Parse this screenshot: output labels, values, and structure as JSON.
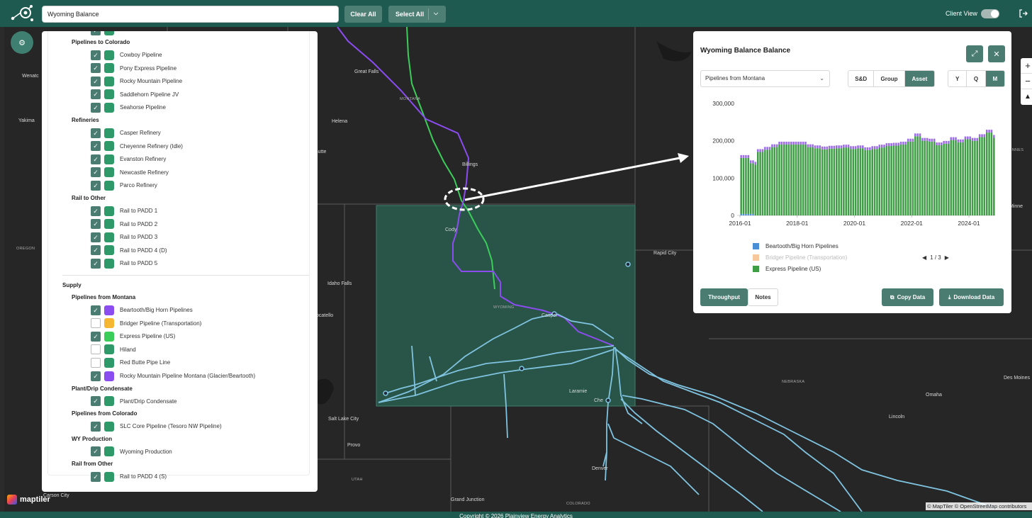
{
  "topbar": {
    "search_value": "Wyoming Balance",
    "clear_all": "Clear All",
    "select_all": "Select All",
    "client_view": "Client View"
  },
  "left_panel": {
    "groups": [
      {
        "title": "Pipelines to Colorado",
        "items": [
          {
            "label": "Cowboy Pipeline",
            "checked": true,
            "color": "#2e9a6a"
          },
          {
            "label": "Pony Express Pipeline",
            "checked": true,
            "color": "#2e9a6a"
          },
          {
            "label": "Rocky Mountain Pipeline",
            "checked": true,
            "color": "#2e9a6a"
          },
          {
            "label": "Saddlehorn Pipeline JV",
            "checked": true,
            "color": "#2e9a6a"
          },
          {
            "label": "Seahorse Pipeline",
            "checked": true,
            "color": "#2e9a6a"
          }
        ]
      },
      {
        "title": "Refineries",
        "items": [
          {
            "label": "Casper Refinery",
            "checked": true,
            "color": "#2e9a6a"
          },
          {
            "label": "Cheyenne Refinery (Idle)",
            "checked": true,
            "color": "#2e9a6a"
          },
          {
            "label": "Evanston Refinery",
            "checked": true,
            "color": "#2e9a6a"
          },
          {
            "label": "Newcastle Refinery",
            "checked": true,
            "color": "#2e9a6a"
          },
          {
            "label": "Parco Refinery",
            "checked": true,
            "color": "#2e9a6a"
          }
        ]
      },
      {
        "title": "Rail to Other",
        "items": [
          {
            "label": "Rail to PADD 1",
            "checked": true,
            "color": "#2e9a6a"
          },
          {
            "label": "Rail to PADD 2",
            "checked": true,
            "color": "#2e9a6a"
          },
          {
            "label": "Rail to PADD 3",
            "checked": true,
            "color": "#2e9a6a"
          },
          {
            "label": "Rail to PADD 4 (D)",
            "checked": true,
            "color": "#2e9a6a"
          },
          {
            "label": "Rail to PADD 5",
            "checked": true,
            "color": "#2e9a6a"
          }
        ]
      }
    ],
    "section": "Supply",
    "supply_groups": [
      {
        "title": "Pipelines from Montana",
        "items": [
          {
            "label": "Beartooth/Big Horn Pipelines",
            "checked": true,
            "color": "#8b4cf0"
          },
          {
            "label": "Bridger Pipeline (Transportation)",
            "checked": false,
            "color": "#f5b731"
          },
          {
            "label": "Express Pipeline (US)",
            "checked": true,
            "color": "#3bcd5a"
          },
          {
            "label": "Hiland",
            "checked": false,
            "color": "#2e9a6a"
          },
          {
            "label": "Red Butte Pipe Line",
            "checked": false,
            "color": "#2e9a6a"
          },
          {
            "label": "Rocky Mountain Pipeline Montana (Glacier/Beartooth)",
            "checked": true,
            "color": "#8b4cf0"
          }
        ]
      },
      {
        "title": "Plant/Drip Condensate",
        "items": [
          {
            "label": "Plant/Drip Condensate",
            "checked": true,
            "color": "#2e9a6a"
          }
        ]
      },
      {
        "title": "Pipelines from Colorado",
        "items": [
          {
            "label": "SLC Core Pipeline (Tesoro NW Pipeline)",
            "checked": true,
            "color": "#2e9a6a"
          }
        ]
      },
      {
        "title": "WY Production",
        "items": [
          {
            "label": "Wyoming Production",
            "checked": true,
            "color": "#2e9a6a"
          }
        ]
      },
      {
        "title": "Rail from Other",
        "items": [
          {
            "label": "Rail to PADD 4 (S)",
            "checked": true,
            "color": "#2e9a6a"
          }
        ]
      }
    ]
  },
  "map": {
    "labels": [
      {
        "text": "Wenatc",
        "cls": ""
      },
      {
        "text": "Yakima",
        "cls": ""
      },
      {
        "text": "OREGON",
        "cls": "small"
      },
      {
        "text": "Great Falls",
        "cls": ""
      },
      {
        "text": "MONTANA",
        "cls": "small"
      },
      {
        "text": "Helena",
        "cls": ""
      },
      {
        "text": "Butte",
        "cls": ""
      },
      {
        "text": "Billings",
        "cls": ""
      },
      {
        "text": "Cody",
        "cls": ""
      },
      {
        "text": "Idaho Falls",
        "cls": ""
      },
      {
        "text": "ocatello",
        "cls": ""
      },
      {
        "text": "WYOMING",
        "cls": "small"
      },
      {
        "text": "Casper",
        "cls": ""
      },
      {
        "text": "Rapid City",
        "cls": ""
      },
      {
        "text": "NEBRASKA",
        "cls": "small"
      },
      {
        "text": "Omaha",
        "cls": ""
      },
      {
        "text": "Lincoln",
        "cls": ""
      },
      {
        "text": "Des Moines",
        "cls": ""
      },
      {
        "text": "MINNES",
        "cls": "small"
      },
      {
        "text": "Minne",
        "cls": ""
      },
      {
        "text": "Laramie",
        "cls": ""
      },
      {
        "text": "Che",
        "cls": ""
      },
      {
        "text": "Salt Lake City",
        "cls": ""
      },
      {
        "text": "Provo",
        "cls": ""
      },
      {
        "text": "UTAH",
        "cls": "small"
      },
      {
        "text": "Denver",
        "cls": ""
      },
      {
        "text": "COLORADO",
        "cls": "small"
      },
      {
        "text": "Grand Junction",
        "cls": ""
      },
      {
        "text": "Carson City",
        "cls": ""
      }
    ],
    "brand": "maptiler",
    "attribution": "© MapTiler © OpenStreetMap contributors"
  },
  "footer": "Copyright © 2026 Plainview Energy Analytics",
  "balance_panel": {
    "title": "Wyoming Balance Balance",
    "dropdown_value": "Pipelines from Montana",
    "view_modes": [
      "S&D",
      "Group",
      "Asset"
    ],
    "active_view": "Asset",
    "periods": [
      "Y",
      "Q",
      "M"
    ],
    "active_period": "M",
    "legend": [
      {
        "name": "Beartooth/Big Horn Pipelines",
        "color": "#4a8fd6",
        "dim": false
      },
      {
        "name": "Bridger Pipeline (Transportation)",
        "color": "#f6c89c",
        "dim": true
      },
      {
        "name": "Express Pipeline (US)",
        "color": "#3f9d46",
        "dim": false
      }
    ],
    "pager": "1 / 3",
    "tabs": [
      "Throughput",
      "Notes"
    ],
    "active_tab": "Throughput",
    "copy_data": "Copy Data",
    "download_data": "Download Data"
  },
  "chart_data": {
    "type": "bar",
    "stacked": true,
    "x_start": "2016-01",
    "x_end": "2024-10",
    "frequency": "monthly",
    "x_tick_labels": [
      "2016-01",
      "2018-01",
      "2020-01",
      "2022-01",
      "2024-01"
    ],
    "y_tick_labels": [
      "0",
      "100,000",
      "200,000",
      "300,000"
    ],
    "ylim": [
      0,
      300000
    ],
    "colors": {
      "Beartooth/Big Horn Pipelines": "#4a8fd6",
      "Express Pipeline (US)": "#3f9d46",
      "Rocky Mountain Pipeline Montana (Glacier/Beartooth)": "#9c6ce8"
    },
    "series": [
      {
        "name": "Beartooth/Big Horn Pipelines",
        "values": [
          4000,
          4000,
          4000,
          4000,
          4000,
          4000,
          0,
          0,
          0,
          0,
          0,
          0,
          0,
          0,
          0,
          0,
          0,
          0,
          0,
          0,
          0,
          0,
          0,
          0,
          0,
          0,
          0,
          0,
          0,
          0,
          0,
          0,
          0,
          0,
          0,
          0,
          0,
          0,
          0,
          0,
          0,
          0,
          0,
          0,
          0,
          0,
          0,
          0,
          0,
          0,
          0,
          0,
          0,
          0,
          0,
          0,
          0,
          0,
          0,
          0,
          0,
          0,
          0,
          0,
          0,
          0,
          0,
          0,
          0,
          0,
          0,
          0,
          0,
          0,
          0,
          0,
          0,
          0,
          0,
          0,
          0,
          0,
          0,
          0,
          0,
          0,
          0,
          0,
          0,
          0,
          0,
          0,
          0,
          0,
          0,
          0,
          0,
          0,
          0,
          0,
          0,
          0,
          0,
          0,
          0,
          0,
          0
        ]
      },
      {
        "name": "Express Pipeline (US)",
        "values": [
          150000,
          150000,
          150000,
          150000,
          136000,
          136000,
          136000,
          170000,
          170000,
          170000,
          176000,
          176000,
          176000,
          183000,
          183000,
          183000,
          190000,
          190000,
          190000,
          190000,
          190000,
          190000,
          190000,
          190000,
          190000,
          190000,
          190000,
          190000,
          183000,
          183000,
          183000,
          180000,
          180000,
          180000,
          177000,
          177000,
          177000,
          179000,
          179000,
          179000,
          180000,
          180000,
          180000,
          182000,
          182000,
          182000,
          178000,
          178000,
          178000,
          180000,
          180000,
          180000,
          175000,
          175000,
          175000,
          178000,
          178000,
          178000,
          182000,
          182000,
          182000,
          186000,
          186000,
          186000,
          187000,
          187000,
          187000,
          190000,
          190000,
          190000,
          198000,
          198000,
          198000,
          212000,
          212000,
          212000,
          200000,
          200000,
          200000,
          198000,
          198000,
          198000,
          188000,
          188000,
          188000,
          192000,
          192000,
          192000,
          202000,
          202000,
          202000,
          196000,
          196000,
          196000,
          204000,
          204000,
          204000,
          200000,
          200000,
          200000,
          210000,
          210000,
          210000,
          222000,
          222000,
          222000,
          208000
        ]
      },
      {
        "name": "Rocky Mountain Pipeline Montana (Glacier/Beartooth)",
        "values": [
          0,
          0,
          0,
          0,
          0,
          0,
          0,
          0,
          0,
          0,
          0,
          0,
          0,
          0,
          0,
          0,
          0,
          0,
          0,
          0,
          0,
          0,
          0,
          0,
          0,
          0,
          0,
          0,
          0,
          0,
          0,
          0,
          0,
          0,
          0,
          0,
          0,
          0,
          0,
          0,
          0,
          0,
          0,
          0,
          0,
          0,
          0,
          0,
          0,
          0,
          0,
          0,
          0,
          0,
          0,
          0,
          0,
          0,
          0,
          0,
          0,
          0,
          0,
          0,
          0,
          0,
          0,
          0,
          0,
          0,
          0,
          0,
          0,
          0,
          0,
          0,
          0,
          0,
          0,
          0,
          0,
          0,
          0,
          0,
          0,
          0,
          0,
          0,
          0,
          0,
          0,
          0,
          0,
          0,
          0,
          0,
          0,
          0,
          0,
          0,
          0,
          0,
          0,
          0,
          0,
          0,
          0
        ]
      }
    ]
  }
}
